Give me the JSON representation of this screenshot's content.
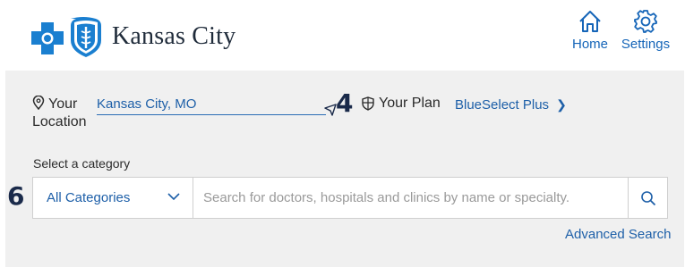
{
  "brand": {
    "name": "Kansas City",
    "logo_icon": "bcbs-cross-and-shield-icon"
  },
  "nav": {
    "home": {
      "label": "Home",
      "icon": "home-icon"
    },
    "settings": {
      "label": "Settings",
      "icon": "gear-icon"
    }
  },
  "location": {
    "label_line1": "Your",
    "label_line2": "Location",
    "value": "Kansas City, MO",
    "icon": "location-pin-icon"
  },
  "plan": {
    "label": "Your Plan",
    "value": "BlueSelect Plus",
    "icon": "shield-icon"
  },
  "callouts": {
    "four": "4",
    "six": "6"
  },
  "category": {
    "label": "Select a category",
    "selected": "All Categories"
  },
  "search": {
    "placeholder": "Search for doctors, hospitals and clinics by name or specialty.",
    "value": ""
  },
  "advanced_search": {
    "label": "Advanced Search"
  },
  "colors": {
    "accent": "#1d5fa8",
    "brand_blue": "#1a7fd0",
    "panel_bg": "#f0f0f0"
  }
}
